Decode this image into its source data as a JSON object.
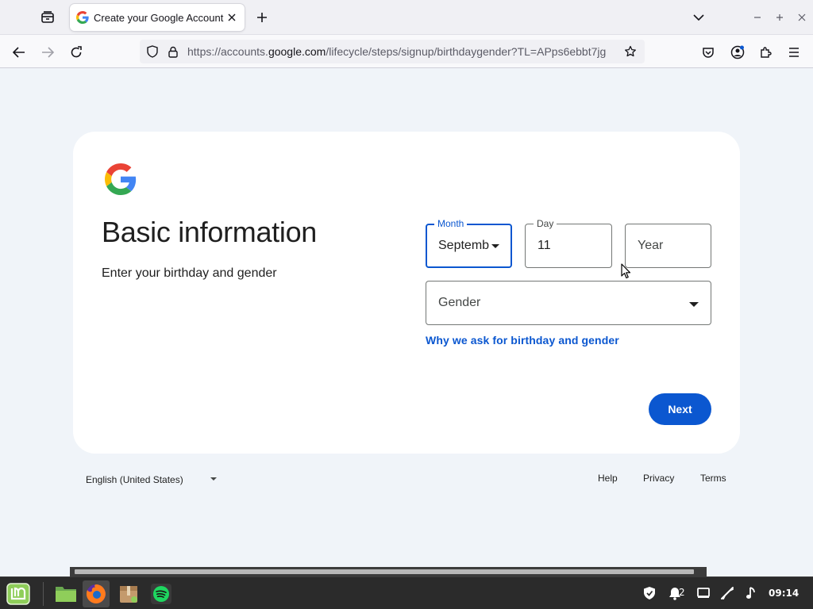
{
  "browser": {
    "tab_title": "Create your Google Account",
    "url_prefix": "https://accounts.",
    "url_domain": "google.com",
    "url_path": "/lifecycle/steps/signup/birthdaygender?TL=APps6ebbt7jg"
  },
  "page": {
    "heading": "Basic information",
    "subheading": "Enter your birthday and gender",
    "month": {
      "label": "Month",
      "value": "Septemb"
    },
    "day": {
      "label": "Day",
      "value": "11"
    },
    "year": {
      "placeholder": "Year"
    },
    "gender": {
      "placeholder": "Gender"
    },
    "why_link": "Why we ask for birthday and gender",
    "next_label": "Next"
  },
  "footer": {
    "language": "English (United States)",
    "help": "Help",
    "privacy": "Privacy",
    "terms": "Terms"
  },
  "taskbar": {
    "notification_count": "2",
    "clock": "09:14"
  },
  "colors": {
    "accent": "#0b57d0",
    "page_bg": "#f0f4f9",
    "taskbar_bg": "#2b2b2b"
  }
}
